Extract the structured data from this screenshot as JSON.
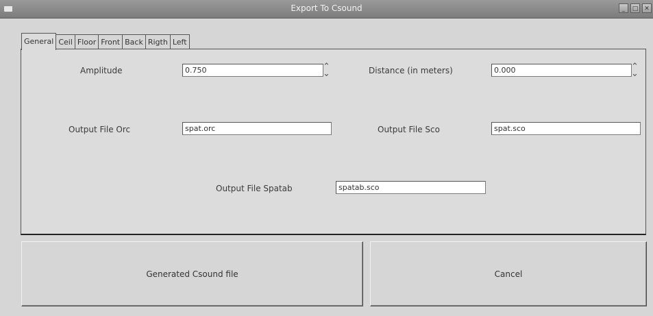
{
  "window": {
    "title": "Export To Csound"
  },
  "tabs": [
    {
      "label": "General"
    },
    {
      "label": "Ceil"
    },
    {
      "label": "Floor"
    },
    {
      "label": "Front"
    },
    {
      "label": "Back"
    },
    {
      "label": "Rigth"
    },
    {
      "label": "Left"
    }
  ],
  "general": {
    "amplitude_label": "Amplitude",
    "amplitude_value": "0.750",
    "distance_label": "Distance (in meters)",
    "distance_value": "0.000",
    "orc_label": "Output File Orc",
    "orc_value": "spat.orc",
    "sco_label": "Output File Sco",
    "sco_value": "spat.sco",
    "spatab_label": "Output File Spatab",
    "spatab_value": "spatab.sco"
  },
  "buttons": {
    "generate_label": "Generated Csound file",
    "cancel_label": "Cancel"
  }
}
